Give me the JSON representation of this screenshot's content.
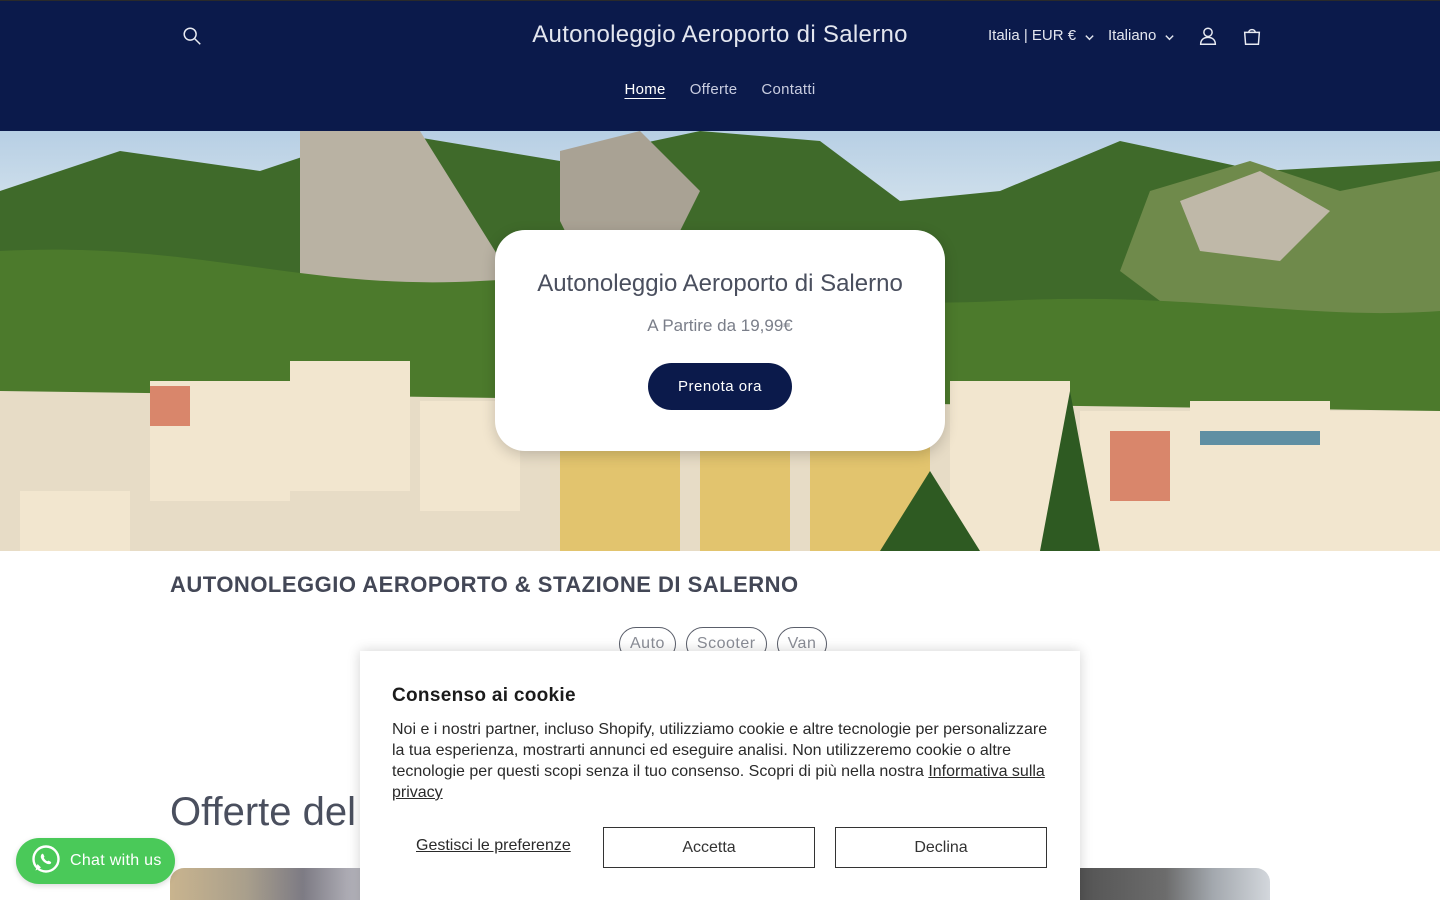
{
  "header": {
    "site_title": "Autonoleggio Aeroporto di Salerno",
    "country_selector": "Italia | EUR €",
    "language_selector": "Italiano",
    "nav": [
      {
        "label": "Home",
        "active": true
      },
      {
        "label": "Offerte",
        "active": false
      },
      {
        "label": "Contatti",
        "active": false
      }
    ],
    "icons": [
      "search-icon",
      "account-icon",
      "cart-icon"
    ],
    "background_color": "#0b1a4b"
  },
  "hero": {
    "title": "Autonoleggio Aeroporto di Salerno",
    "subtitle": "A Partire da 19,99€",
    "cta_label": "Prenota ora"
  },
  "section": {
    "title": "AUTONOLEGGIO AEROPORTO & STAZIONE DI SALERNO",
    "vehicle_types": [
      "Auto",
      "Scooter",
      "Van"
    ]
  },
  "offers": {
    "title_visible": "Offerte del"
  },
  "cookie_banner": {
    "title": "Consenso ai cookie",
    "text": "Noi e i nostri partner, incluso Shopify, utilizziamo cookie e altre tecnologie per personalizzare la tua esperienza, mostrarti annunci ed eseguire analisi. Non utilizzeremo cookie o altre tecnologie per questi scopi senza il tuo consenso. Scopri di più nella nostra",
    "privacy_link": "Informativa sulla privacy",
    "manage_label": "Gestisci le preferenze",
    "accept_label": "Accetta",
    "decline_label": "Declina"
  },
  "chat_widget": {
    "label": "Chat with us",
    "icon": "whatsapp-icon",
    "color": "#4ac959"
  }
}
